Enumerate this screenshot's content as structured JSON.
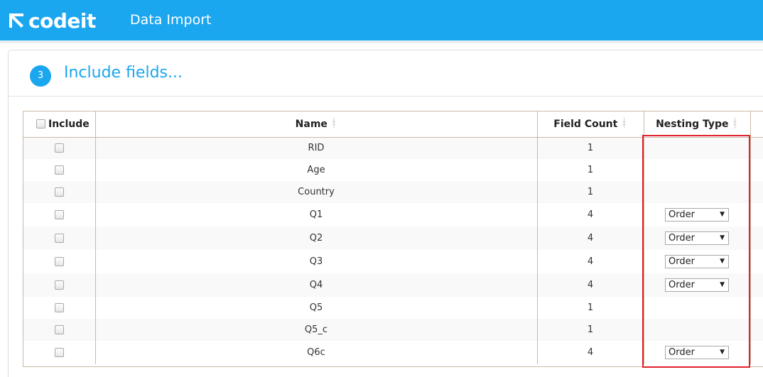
{
  "header": {
    "brand": "codeit",
    "title": "Data Import"
  },
  "step": {
    "number": "3",
    "title": "Include fields..."
  },
  "table": {
    "columns": [
      "Include",
      "Name",
      "Field Count",
      "Nesting Type"
    ],
    "rows": [
      {
        "name": "RID",
        "count": "1",
        "nesting": ""
      },
      {
        "name": "Age",
        "count": "1",
        "nesting": ""
      },
      {
        "name": "Country",
        "count": "1",
        "nesting": ""
      },
      {
        "name": "Q1",
        "count": "4",
        "nesting": "Order"
      },
      {
        "name": "Q2",
        "count": "4",
        "nesting": "Order"
      },
      {
        "name": "Q3",
        "count": "4",
        "nesting": "Order"
      },
      {
        "name": "Q4",
        "count": "4",
        "nesting": "Order"
      },
      {
        "name": "Q5",
        "count": "1",
        "nesting": ""
      },
      {
        "name": "Q5_c",
        "count": "1",
        "nesting": ""
      },
      {
        "name": "Q6c",
        "count": "4",
        "nesting": "Order"
      }
    ]
  },
  "colors": {
    "brand": "#1ba6f0",
    "highlight": "#e0202a"
  }
}
